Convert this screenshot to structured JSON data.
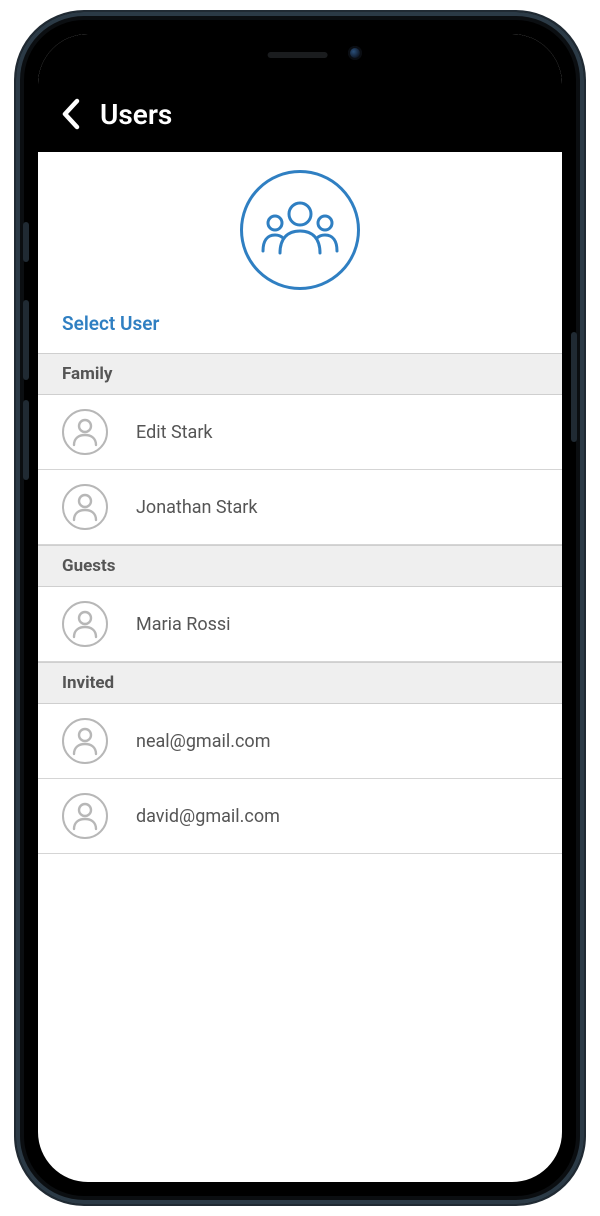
{
  "navbar": {
    "title": "Users"
  },
  "subheading": "Select User",
  "sections": [
    {
      "title": "Family",
      "items": [
        "Edit Stark",
        "Jonathan Stark"
      ]
    },
    {
      "title": "Guests",
      "items": [
        "Maria Rossi"
      ]
    },
    {
      "title": "Invited",
      "items": [
        "neal@gmail.com",
        "david@gmail.com"
      ]
    }
  ],
  "colors": {
    "accent": "#2f7fc2"
  }
}
